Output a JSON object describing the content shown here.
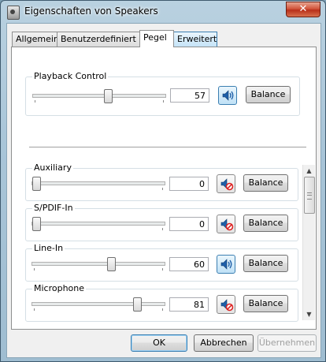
{
  "window": {
    "title": "Eigenschaften von Speakers",
    "close_label": "✕"
  },
  "tabs": [
    {
      "label": "Allgemein"
    },
    {
      "label": "Benutzerdefiniert"
    },
    {
      "label": "Pegel"
    },
    {
      "label": "Erweitert"
    }
  ],
  "master": {
    "label": "Playback Control",
    "value": "57",
    "level": 0.57,
    "muted": false,
    "balance_label": "Balance"
  },
  "channels": [
    {
      "label": "Auxiliary",
      "value": "0",
      "level": 0.0,
      "muted": true,
      "balance_label": "Balance"
    },
    {
      "label": "S/PDIF-In",
      "value": "0",
      "level": 0.0,
      "muted": true,
      "balance_label": "Balance"
    },
    {
      "label": "Line-In",
      "value": "60",
      "level": 0.6,
      "muted": false,
      "balance_label": "Balance"
    },
    {
      "label": "Microphone",
      "value": "81",
      "level": 0.81,
      "muted": true,
      "balance_label": "Balance"
    }
  ],
  "footer": {
    "ok": "OK",
    "cancel": "Abbrechen",
    "apply": "Übernehmen"
  }
}
